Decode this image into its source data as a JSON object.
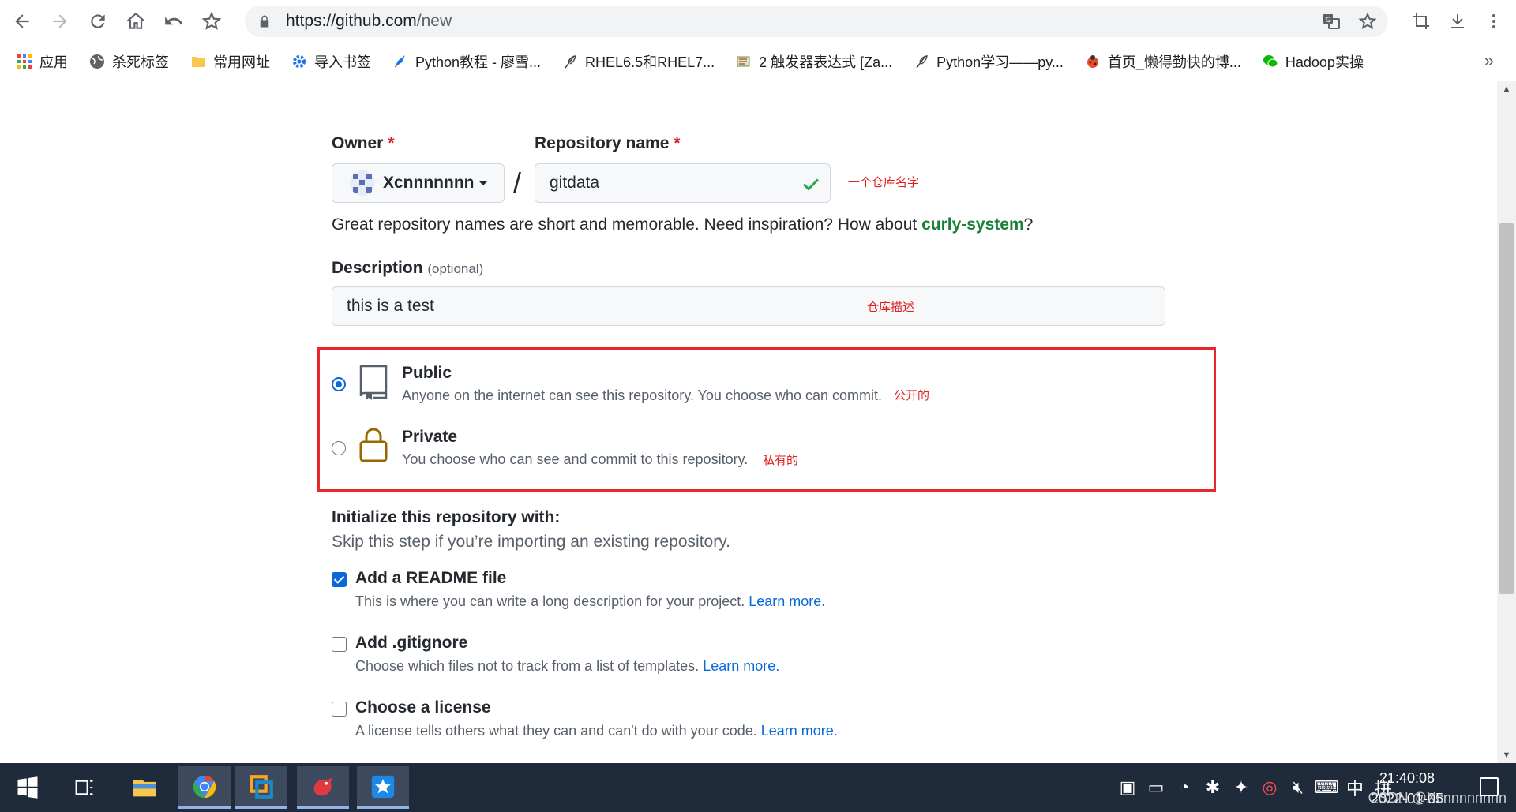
{
  "browser": {
    "url_host": "https://github.com",
    "url_path": "/new"
  },
  "bookmarks": [
    {
      "label": "应用",
      "icon": "apps-grid-icon"
    },
    {
      "label": "杀死标签",
      "icon": "globe-icon"
    },
    {
      "label": "常用网址",
      "icon": "folder-icon"
    },
    {
      "label": "导入书签",
      "icon": "gear-icon"
    },
    {
      "label": "Python教程 - 廖雪...",
      "icon": "rocket-icon"
    },
    {
      "label": "RHEL6.5和RHEL7...",
      "icon": "feather-icon"
    },
    {
      "label": "2 触发器表达式 [Za...",
      "icon": "book-icon"
    },
    {
      "label": "Python学习——py...",
      "icon": "feather-icon"
    },
    {
      "label": "首页_懒得勤快的博...",
      "icon": "ladybug-icon"
    },
    {
      "label": "Hadoop实操",
      "icon": "wechat-icon"
    }
  ],
  "form": {
    "owner_label": "Owner",
    "owner_value": "Xcnnnnnnn",
    "repo_label": "Repository name",
    "repo_value": "gitdata",
    "required_mark": "*",
    "slash": "/",
    "hint_text": "Great repository names are short and memorable. Need inspiration? How about ",
    "hint_suggestion": "curly-system",
    "hint_end": "?",
    "description_label": "Description",
    "description_optional": "(optional)",
    "description_value": "this is a test"
  },
  "annotations": {
    "repo_name": "一个仓库名字",
    "description": "仓库描述",
    "public": "公开的",
    "private": "私有的"
  },
  "visibility": {
    "public_title": "Public",
    "public_desc": "Anyone on the internet can see this repository. You choose who can commit.",
    "private_title": "Private",
    "private_desc": "You choose who can see and commit to this repository.",
    "selected": "public"
  },
  "initialize": {
    "title": "Initialize this repository with:",
    "subtitle": "Skip this step if you’re importing an existing repository.",
    "options": [
      {
        "label": "Add a README file",
        "desc": "This is where you can write a long description for your project. ",
        "link": "Learn more.",
        "checked": true
      },
      {
        "label": "Add .gitignore",
        "desc": "Choose which files not to track from a list of templates. ",
        "link": "Learn more.",
        "checked": false
      },
      {
        "label": "Choose a license",
        "desc": "A license tells others what they can and can't do with your code. ",
        "link": "Learn more.",
        "checked": false
      }
    ]
  },
  "taskbar": {
    "time": "21:40:08",
    "date": "2022-01-05",
    "ime_lang": "中",
    "ime_mode": "拼",
    "watermark": "CSDN @Xcnnnnnnnn"
  },
  "colors": {
    "accent": "#0969da",
    "success": "#2da44e",
    "suggestion": "#1a7f37",
    "annotation": "#e02020",
    "highlight_box": "#e8272c"
  }
}
